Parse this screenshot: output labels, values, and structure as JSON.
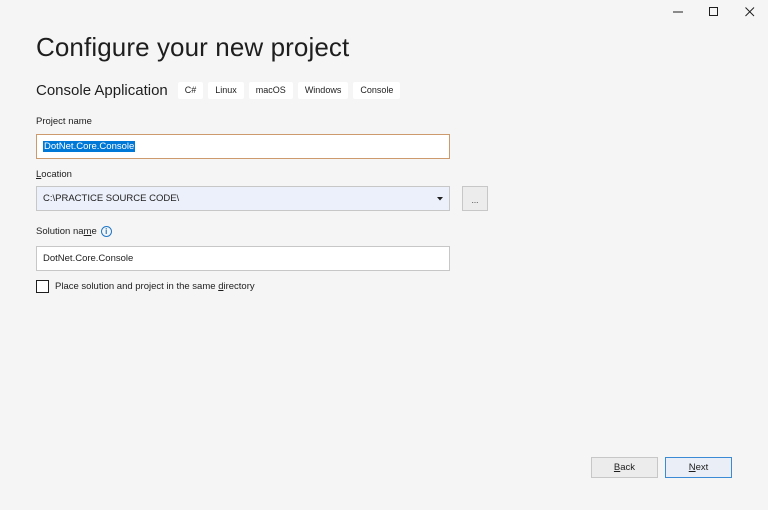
{
  "window": {
    "controls": {
      "minimize_icon": "minimize-icon",
      "maximize_icon": "maximize-icon",
      "close_icon": "close-icon"
    }
  },
  "header": {
    "title": "Configure your new project",
    "template_name": "Console Application",
    "tags": [
      "C#",
      "Linux",
      "macOS",
      "Windows",
      "Console"
    ]
  },
  "form": {
    "project_name": {
      "label": "Project name",
      "value": "DotNet.Core.Console"
    },
    "location": {
      "label_accel": "L",
      "label_rest": "ocation",
      "value": "C:\\PRACTICE SOURCE CODE\\",
      "browse_label": "..."
    },
    "solution_name": {
      "label_pre": "Solution na",
      "label_accel": "m",
      "label_post": "e",
      "info_glyph": "i",
      "value": "DotNet.Core.Console"
    },
    "same_directory": {
      "label_pre": "Place solution and project in the same ",
      "label_accel": "d",
      "label_post": "irectory",
      "checked": false
    }
  },
  "footer": {
    "back": {
      "accel": "B",
      "rest": "ack"
    },
    "next": {
      "accel": "N",
      "rest": "ext"
    }
  },
  "colors": {
    "background": "#f5f5f5",
    "focus_border": "#cc9a6c",
    "selection": "#0078d7",
    "primary_border": "#3b8ad6",
    "info": "#1e78c8"
  }
}
